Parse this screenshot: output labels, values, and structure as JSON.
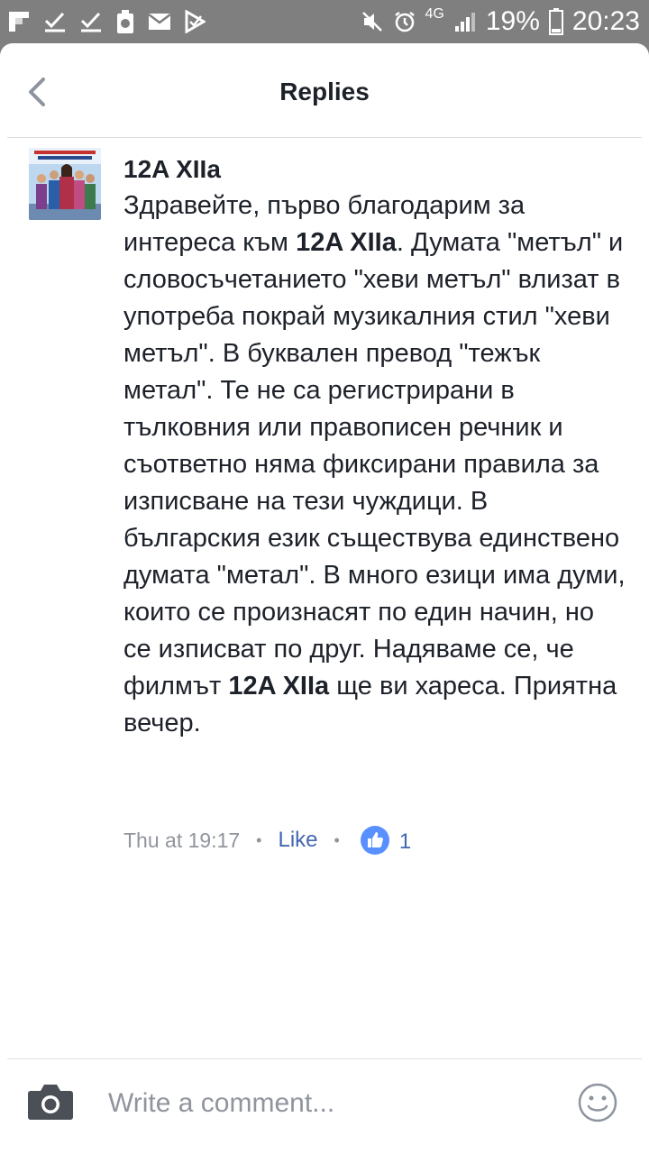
{
  "status_bar": {
    "network": "4G",
    "battery": "19%",
    "time": "20:23"
  },
  "header": {
    "title": "Replies"
  },
  "comment": {
    "author": "12A XIIa",
    "segments": [
      {
        "text": "Здравейте, първо благодарим за интереса към ",
        "bold": false
      },
      {
        "text": "12A XIIa",
        "bold": true
      },
      {
        "text": ". Думата \"метъл\" и словосъчетанието \"хеви метъл\" влизат в употреба покрай музикалния стил \"хеви метъл\". В буквален превод \"тежък метал\". Те не са регистрирани в тълковния или правописен речник и съответно няма фиксирани правила за изписване на тези чуждици. В българския език съществува единствено думата \"метал\". В много езици има думи, които се произнасят по един начин, но се изписват по друг. Надяваме се, че филмът ",
        "bold": false
      },
      {
        "text": "12A XIIa",
        "bold": true
      },
      {
        "text": " ще ви хареса. Приятна вечер.",
        "bold": false
      }
    ],
    "timestamp": "Thu at 19:17",
    "dot": "•",
    "like_label": "Like",
    "like_count": "1"
  },
  "composer": {
    "placeholder": "Write a comment..."
  },
  "colors": {
    "accent": "#4267b2",
    "like_badge": "#5890ff",
    "muted": "#90949c",
    "text": "#1d2129"
  }
}
